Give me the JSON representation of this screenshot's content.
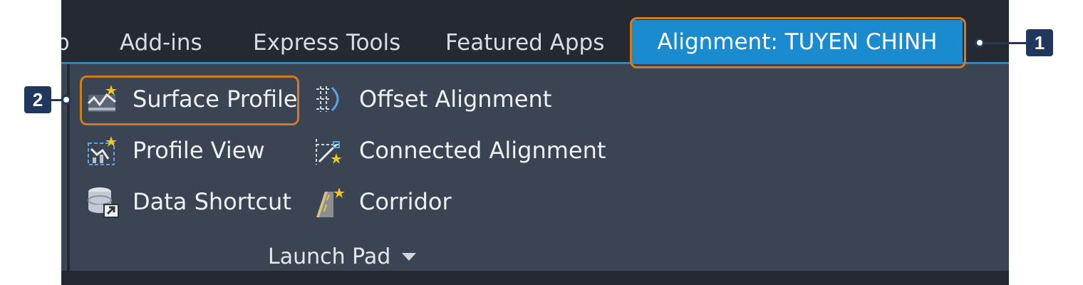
{
  "ribbon": {
    "tabs": [
      {
        "label": "p"
      },
      {
        "label": "Add-ins"
      },
      {
        "label": "Express Tools"
      },
      {
        "label": "Featured Apps"
      }
    ],
    "active_tab": {
      "label": "Alignment: TUYEN CHINH"
    },
    "accent_color": "#1b8bd0"
  },
  "panel": {
    "commands_left": [
      {
        "label": "Surface Profile",
        "icon": "surface-profile-icon"
      },
      {
        "label": "Profile View",
        "icon": "profile-view-icon"
      },
      {
        "label": "Data Shortcut",
        "icon": "data-shortcut-icon"
      }
    ],
    "commands_right": [
      {
        "label": "Offset Alignment",
        "icon": "offset-alignment-icon"
      },
      {
        "label": "Connected Alignment",
        "icon": "connected-alignment-icon"
      },
      {
        "label": "Corridor",
        "icon": "corridor-icon"
      }
    ],
    "group_label": "Launch Pad",
    "group_dropdown_icon": "caret-down-icon"
  },
  "callouts": [
    {
      "number": "1",
      "target": "Alignment: TUYEN CHINH"
    },
    {
      "number": "2",
      "target": "Surface Profile"
    }
  ],
  "callout_colors": {
    "highlight": "#d27b1d",
    "badge": "#20385d"
  }
}
